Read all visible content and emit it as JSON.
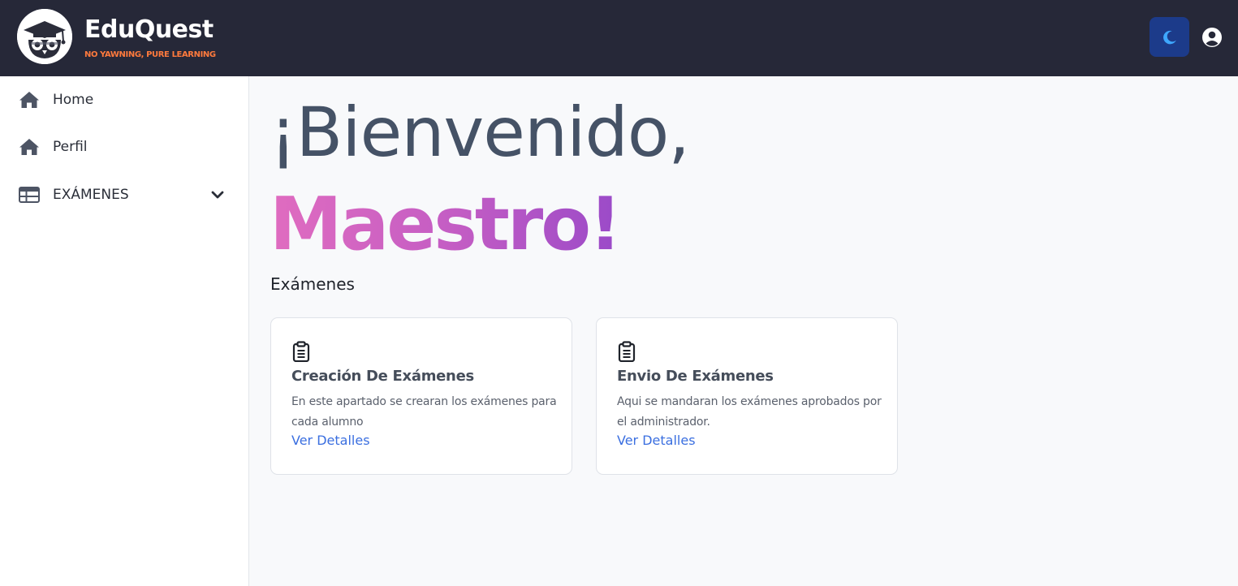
{
  "header": {
    "brand_name": "EduQuest",
    "brand_tagline": "NO YAWNING, PURE LEARNING",
    "logo_icon": "owl-graduate-logo",
    "theme_toggle_icon": "moon-icon",
    "user_icon": "user-circle-icon",
    "colors": {
      "background": "#262838",
      "tagline": "#ff7a3d",
      "theme_button": "#1c3b8a"
    }
  },
  "sidebar": {
    "items": [
      {
        "label": "Home",
        "icon": "home-icon"
      },
      {
        "label": "Perfil",
        "icon": "home-icon"
      },
      {
        "label": "EXÁMENES",
        "icon": "table-icon",
        "expandable": true,
        "expander_icon": "chevron-down-icon"
      }
    ]
  },
  "main": {
    "greeting": "¡Bienvenido,",
    "greeting_name": "Maestro!",
    "section_title": "Exámenes",
    "cards": [
      {
        "icon": "clipboard-icon",
        "title": "Creación De Exámenes",
        "description": "En este apartado se crearan los exámenes para cada alumno",
        "link": "Ver Detalles"
      },
      {
        "icon": "clipboard-icon",
        "title": "Envio De Exámenes",
        "description": "Aqui se mandaran los exámenes aprobados por el administrador.",
        "link": "Ver Detalles"
      }
    ],
    "colors": {
      "greeting": "#455266",
      "name_gradient_start": "#e06cc0",
      "name_gradient_end": "#9a4ac8",
      "link": "#3b6fe0"
    }
  }
}
